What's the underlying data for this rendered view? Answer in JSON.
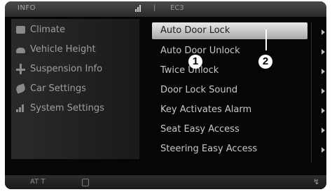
{
  "header": {
    "title": "INFO",
    "separator": "|",
    "ext_label": "EC3"
  },
  "left_menu": [
    {
      "label": "Climate",
      "icon": "climate-icon"
    },
    {
      "label": "Vehicle Height",
      "icon": "car-icon"
    },
    {
      "label": "Suspension Info",
      "icon": "suspension-icon"
    },
    {
      "label": "Car Settings",
      "icon": "wrench-icon"
    },
    {
      "label": "System Settings",
      "icon": "signal-icon"
    }
  ],
  "right_menu": {
    "selected_index": 0,
    "items": [
      {
        "label": "Auto Door Lock"
      },
      {
        "label": "Auto Door Unlock"
      },
      {
        "label": "Twice Unlock"
      },
      {
        "label": "Door Lock Sound"
      },
      {
        "label": "Key Activates Alarm"
      },
      {
        "label": "Seat Easy Access"
      },
      {
        "label": "Steering Easy Access"
      }
    ]
  },
  "bottom": {
    "left_text": "AT T",
    "right_icon": "navigate-icon",
    "right_glyph": "↯"
  },
  "callouts": [
    "1",
    "2"
  ],
  "colors": {
    "background": "#060606",
    "selected_gradient_top": "#e8e8e8",
    "selected_gradient_bottom": "#a8a8a8",
    "text_inactive": "#9f9f9f",
    "text_active": "#c8c8c8",
    "callout": "#ffffff"
  }
}
